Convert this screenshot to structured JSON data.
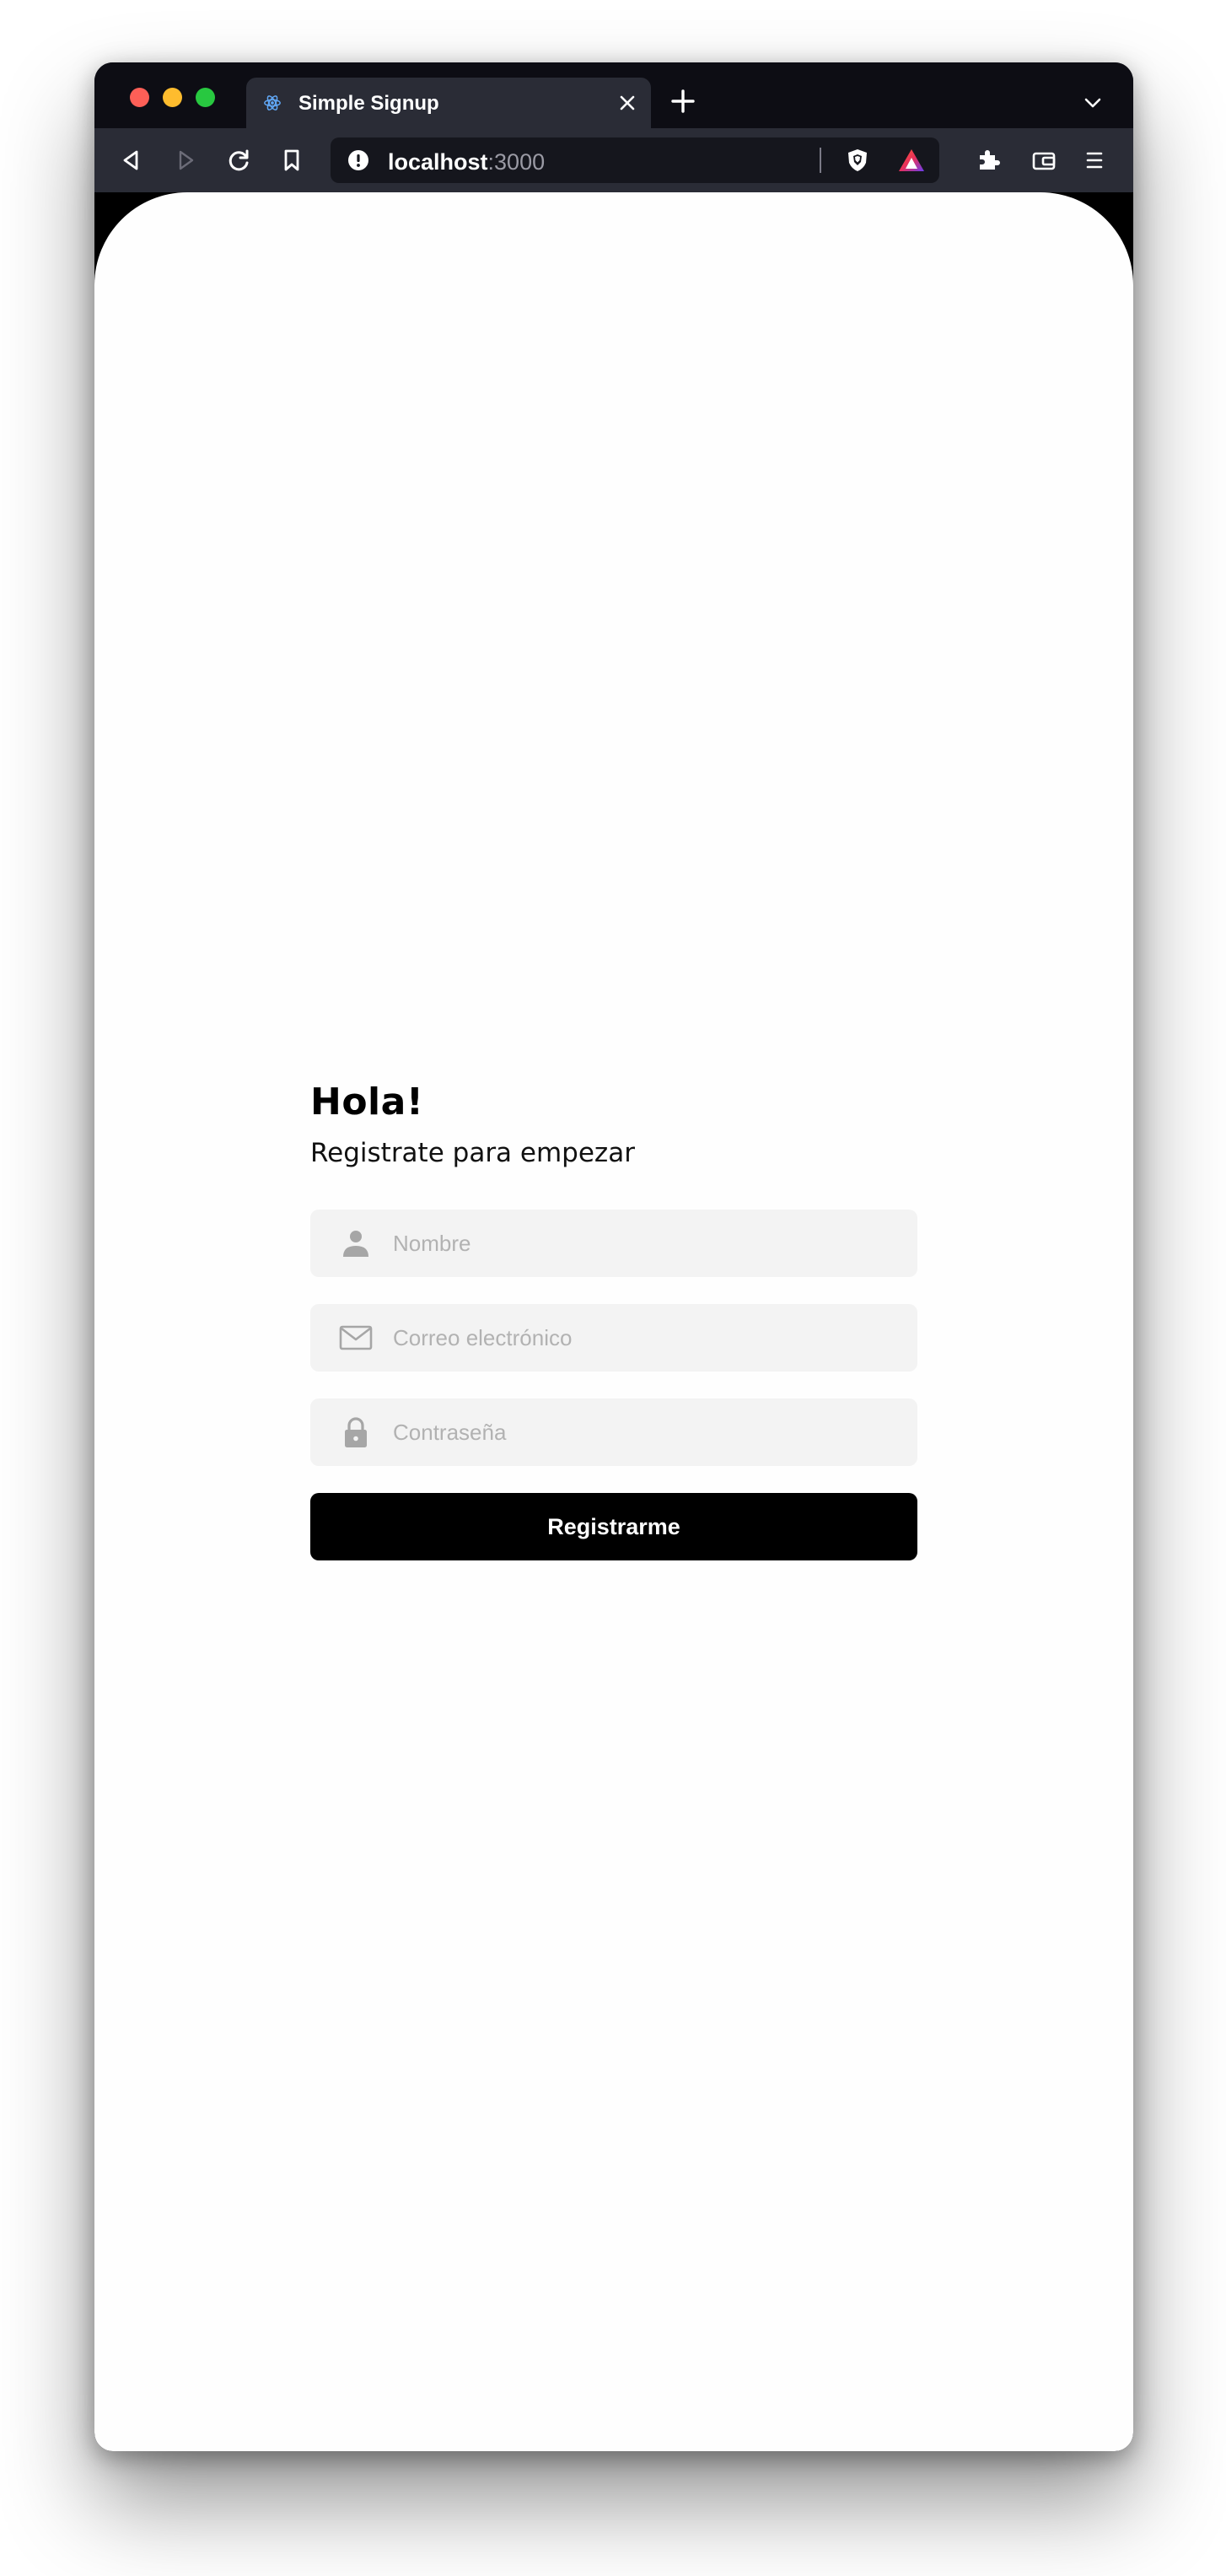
{
  "browser": {
    "tab": {
      "title": "Simple Signup",
      "favicon": "react-logo-icon"
    },
    "url": {
      "host": "localhost",
      "port": ":3000"
    },
    "icons": {
      "back": "back-arrow-icon",
      "forward": "forward-arrow-icon",
      "reload": "reload-icon",
      "bookmark": "bookmark-icon",
      "site_info": "info-icon",
      "shields": "brave-shields-icon",
      "rewards": "brave-rewards-icon",
      "extensions": "puzzle-icon",
      "wallet": "wallet-icon",
      "menu": "hamburger-menu-icon",
      "new_tab": "plus-icon",
      "close_tab": "close-icon",
      "tab_list": "chevron-down-icon"
    }
  },
  "signup": {
    "title": "Hola!",
    "subtitle": "Registrate para empezar",
    "fields": {
      "name": {
        "placeholder": "Nombre",
        "icon": "user-icon"
      },
      "email": {
        "placeholder": "Correo electrónico",
        "icon": "envelope-icon"
      },
      "password": {
        "placeholder": "Contraseña",
        "icon": "lock-icon"
      }
    },
    "submit_label": "Registrarme"
  },
  "colors": {
    "page_background": "#fefefe",
    "field_background": "#f3f3f3",
    "placeholder": "#b2b2b2",
    "icon": "#a6a6a6",
    "button": "#000000",
    "button_text": "#ffffff",
    "browser_chrome": "#2a2c36"
  }
}
